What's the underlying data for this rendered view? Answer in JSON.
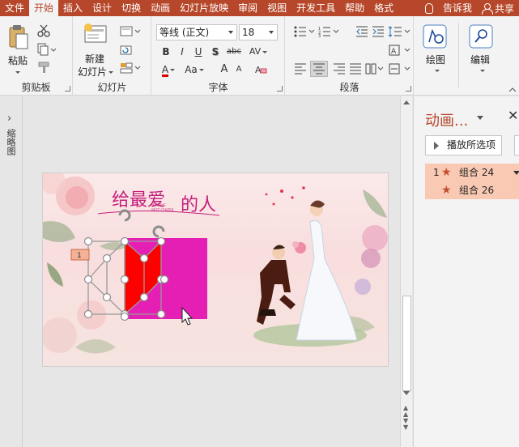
{
  "tabs": [
    "文件",
    "开始",
    "插入",
    "设计",
    "切换",
    "动画",
    "幻灯片放映",
    "审阅",
    "视图",
    "开发工具",
    "帮助",
    "格式"
  ],
  "active_tab": "开始",
  "tell_me": "告诉我",
  "share": "共享",
  "ribbon": {
    "clipboard": {
      "paste": "粘贴",
      "label": "剪贴板"
    },
    "slides": {
      "new_slide_line1": "新建",
      "new_slide_line2": "幻灯片",
      "label": "幻灯片"
    },
    "font": {
      "font_name": "等线 (正文)",
      "font_size": "18",
      "bold": "B",
      "italic": "I",
      "underline": "U",
      "shadow": "S",
      "strike": "abc",
      "spacing": "AV",
      "font_color": "A",
      "change_case": "Aa",
      "grow": "A",
      "shrink": "A",
      "label": "字体"
    },
    "paragraph": {
      "label": "段落"
    },
    "drawing": {
      "label": "绘图"
    },
    "editing": {
      "label": "编辑"
    }
  },
  "left_panel": {
    "label": "缩略图"
  },
  "slide": {
    "title_left": "给最爱",
    "title_right": "的人",
    "small_text_1": "MY LOVE",
    "small_text_2": "BEST CENTER",
    "anim_marker": "1"
  },
  "animation_pane": {
    "title": "动画...",
    "play_button": "播放所选项",
    "items": [
      {
        "num": "1",
        "label": "组合 24"
      },
      {
        "num": "",
        "label": "组合 26"
      }
    ]
  },
  "colors": {
    "brand": "#b7472a",
    "shape_red": "#ff0000",
    "shape_magenta": "#e61fb4"
  }
}
